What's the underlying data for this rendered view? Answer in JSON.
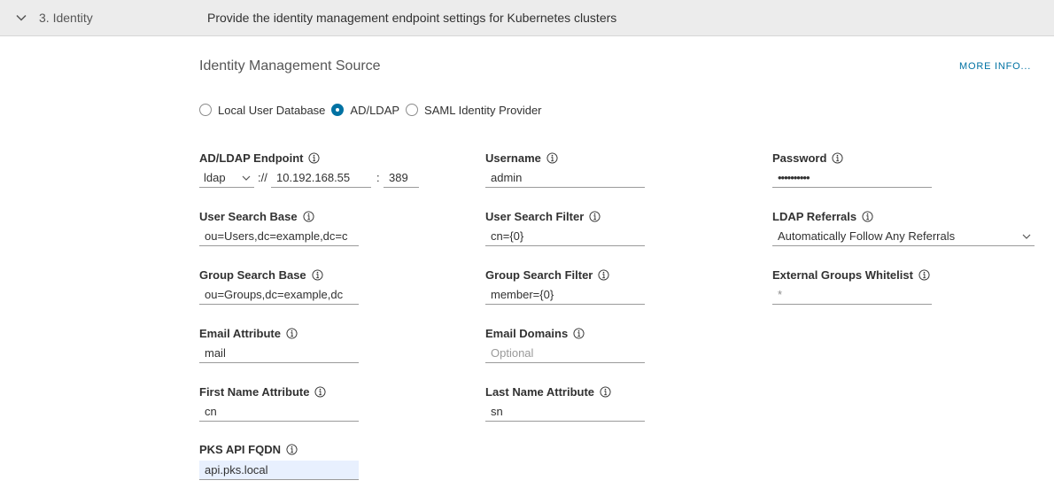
{
  "header": {
    "step_title": "3. Identity",
    "step_description": "Provide the identity management endpoint settings for Kubernetes clusters"
  },
  "section": {
    "title": "Identity Management Source",
    "more_info": "MORE INFO..."
  },
  "source_options": [
    {
      "label": "Local User Database",
      "checked": false
    },
    {
      "label": "AD/LDAP",
      "checked": true
    },
    {
      "label": "SAML Identity Provider",
      "checked": false
    }
  ],
  "fields": {
    "endpoint": {
      "label": "AD/LDAP Endpoint",
      "protocol": "ldap",
      "separator": "://",
      "host": "10.192.168.55",
      "port_separator": ":",
      "port": "389"
    },
    "username": {
      "label": "Username",
      "value": "admin"
    },
    "password": {
      "label": "Password",
      "value": "••••••••••"
    },
    "user_search_base": {
      "label": "User Search Base",
      "value": "ou=Users,dc=example,dc=c"
    },
    "user_search_filter": {
      "label": "User Search Filter",
      "value": "cn={0}"
    },
    "ldap_referrals": {
      "label": "LDAP Referrals",
      "value": "Automatically Follow Any Referrals"
    },
    "group_search_base": {
      "label": "Group Search Base",
      "value": "ou=Groups,dc=example,dc"
    },
    "group_search_filter": {
      "label": "Group Search Filter",
      "value": "member={0}"
    },
    "external_groups_whitelist": {
      "label": "External Groups Whitelist",
      "value": "*"
    },
    "email_attribute": {
      "label": "Email Attribute",
      "value": "mail"
    },
    "email_domains": {
      "label": "Email Domains",
      "placeholder": "Optional"
    },
    "first_name_attribute": {
      "label": "First Name Attribute",
      "value": "cn"
    },
    "last_name_attribute": {
      "label": "Last Name Attribute",
      "value": "sn"
    },
    "pks_api_fqdn": {
      "label": "PKS API FQDN",
      "value": "api.pks.local"
    }
  },
  "colors": {
    "accent": "#0072a3",
    "header_bg": "#ececec",
    "autofill_bg": "#e8f0fe"
  }
}
